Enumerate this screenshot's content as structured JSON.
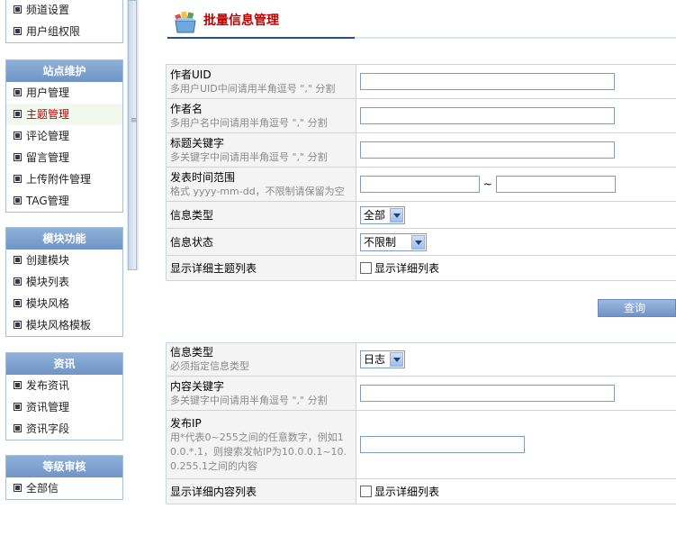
{
  "sidebar": {
    "top_items": [
      "频道设置",
      "用户组权限"
    ],
    "site_panel": {
      "title": "站点维护",
      "items": [
        "用户管理",
        "主题管理",
        "评论管理",
        "留言管理",
        "上传附件管理",
        "TAG管理"
      ],
      "active": "主题管理"
    },
    "module_panel": {
      "title": "模块功能",
      "items": [
        "创建模块",
        "模块列表",
        "模块风格",
        "模块风格模板"
      ]
    },
    "news_panel": {
      "title": "资讯",
      "items": [
        "发布资讯",
        "资讯管理",
        "资讯字段"
      ]
    },
    "level_panel": {
      "title": "等级审核",
      "items": [
        "全部信"
      ]
    }
  },
  "header": {
    "title": "批量信息管理"
  },
  "form1": {
    "uid": {
      "label": "作者UID",
      "hint": "多用户UID中间请用半角逗号 \",\" 分割",
      "value": ""
    },
    "author": {
      "label": "作者名",
      "hint": "多用户名中间请用半角逗号 \",\" 分割",
      "value": ""
    },
    "keyword": {
      "label": "标题关键字",
      "hint": "多关键字中间请用半角逗号 \",\" 分割",
      "value": ""
    },
    "date": {
      "label": "发表时间范围",
      "hint": "格式 yyyy-mm-dd，不限制请保留为空",
      "separator": "~",
      "from": "",
      "to": ""
    },
    "type": {
      "label": "信息类型",
      "value": "全部"
    },
    "status": {
      "label": "信息状态",
      "value": "不限制"
    },
    "detail": {
      "label": "显示详细主题列表",
      "checkbox_label": "显示详细列表"
    }
  },
  "query_button": "查询",
  "form2": {
    "type": {
      "label": "信息类型",
      "hint": "必须指定信息类型",
      "value": "日志"
    },
    "content_keyword": {
      "label": "内容关键字",
      "hint": "多关键字中间请用半角逗号 \",\" 分割",
      "value": ""
    },
    "ip": {
      "label": "发布IP",
      "hint": "用*代表0~255之间的任意数字，例如10.0.*.1，则搜索发帖IP为10.0.0.1~10.0.255.1之间的内容",
      "value": ""
    },
    "detail": {
      "label": "显示详细内容列表",
      "checkbox_label": "显示详细列表"
    }
  }
}
